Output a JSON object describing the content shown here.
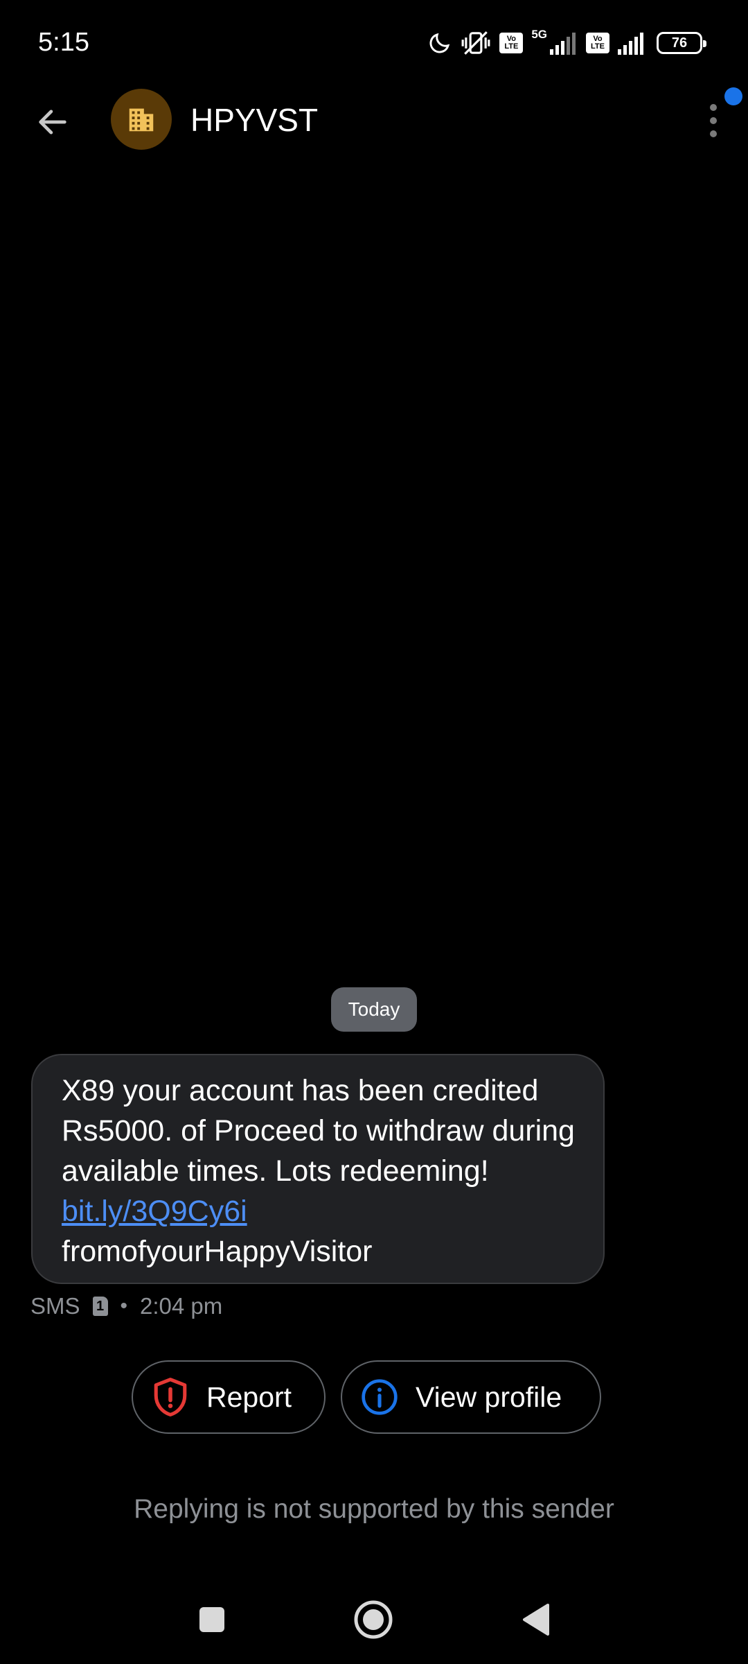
{
  "status_bar": {
    "time": "5:15",
    "network": "5G",
    "volte_1": [
      "Vo",
      "LTE"
    ],
    "volte_2": [
      "Vo",
      "LTE"
    ],
    "battery": "76",
    "icons": [
      "moon-icon",
      "vibrate-icon",
      "alarm-off-icon",
      "volte-icon",
      "signal-icon",
      "volte-icon",
      "signal-icon",
      "battery-icon"
    ]
  },
  "header": {
    "contact_name": "HPYVST",
    "avatar_icon": "building-icon",
    "back_icon": "arrow-left-icon",
    "menu_icon": "more-vertical-icon",
    "notification_dot_color": "#1a73e8",
    "avatar_color": "#5a3a07"
  },
  "conversation": {
    "date_chip": "Today",
    "message": {
      "text_part": "X89 your account has been credited Rs5000. of Proceed to withdraw during available times. Lots redeeming! ",
      "link": "bit.ly/3Q9Cy6i",
      "text_after": "fromofyourHappyVisitor",
      "type": "SMS",
      "sim": "1",
      "time": "2:04 pm"
    }
  },
  "actions": {
    "report_label": "Report",
    "report_icon": "shield-alert-icon",
    "report_color": "#e53935",
    "view_profile_label": "View profile",
    "view_profile_icon": "info-circle-icon",
    "view_profile_color": "#1a73e8"
  },
  "footer": {
    "reply_note": "Replying is not supported by this sender"
  },
  "nav": {
    "icons": [
      "recents-square-icon",
      "home-circle-icon",
      "back-triangle-icon"
    ]
  }
}
